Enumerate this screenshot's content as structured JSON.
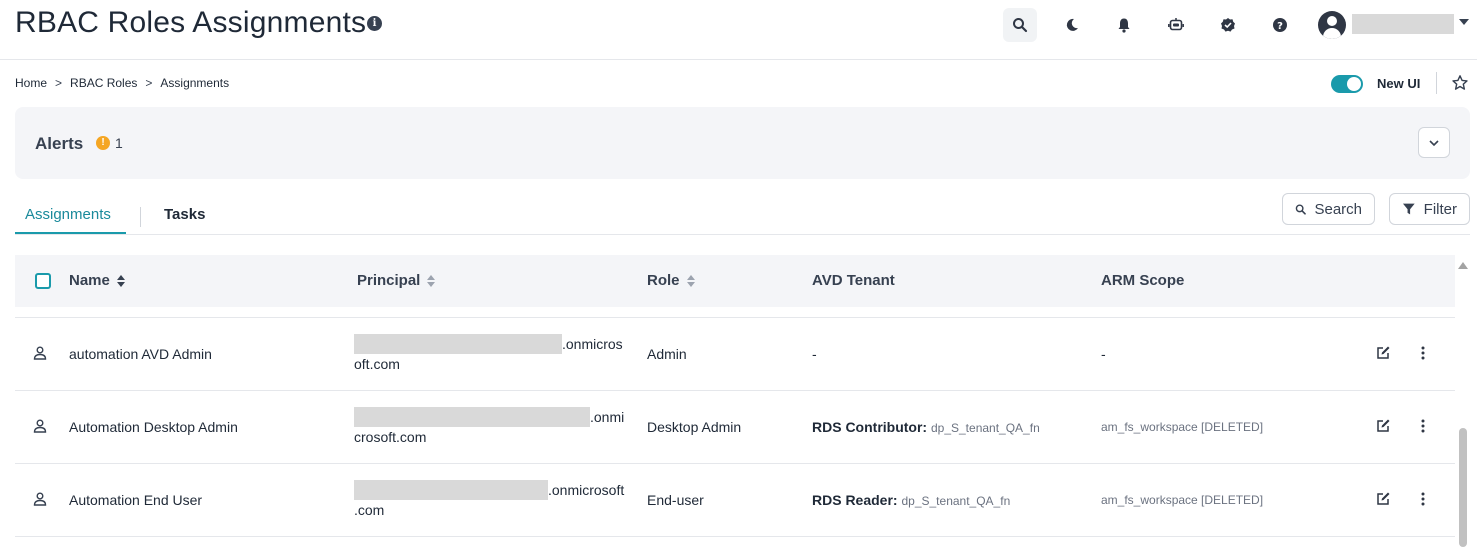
{
  "header": {
    "title": "RBAC Roles Assignments",
    "icons": [
      "search-icon",
      "moon-icon",
      "bell-icon",
      "bot-icon",
      "check-badge-icon",
      "help-icon",
      "user-icon"
    ]
  },
  "breadcrumb": {
    "items": [
      "Home",
      "RBAC Roles",
      "Assignments"
    ],
    "separator": ">"
  },
  "toggle": {
    "label": "New UI",
    "on": true
  },
  "alerts": {
    "title": "Alerts",
    "count": "1"
  },
  "tabs": {
    "assignments": "Assignments",
    "tasks": "Tasks"
  },
  "toolbar": {
    "search_label": "Search",
    "filter_label": "Filter"
  },
  "table": {
    "columns": {
      "name": "Name",
      "principal": "Principal",
      "role": "Role",
      "avd_tenant": "AVD Tenant",
      "arm_scope": "ARM Scope"
    },
    "rows": [
      {
        "name": "automation AVD Admin",
        "principal_suffix_line1": ".onmicros",
        "principal_suffix_line2": "oft.com",
        "role": "Admin",
        "tenant_role": "-",
        "tenant_name": "",
        "scope": "-"
      },
      {
        "name": "Automation Desktop Admin",
        "principal_suffix_line1": ".onmi",
        "principal_suffix_line2": "crosoft.com",
        "role": "Desktop Admin",
        "tenant_role": "RDS Contributor:",
        "tenant_name": "dp_S_tenant_QA_fn",
        "scope": "am_fs_workspace [DELETED]"
      },
      {
        "name": "Automation End User",
        "principal_suffix_line1": ".onmicrosoft",
        "principal_suffix_line2": ".com",
        "role": "End-user",
        "tenant_role": "RDS Reader:",
        "tenant_name": "dp_S_tenant_QA_fn",
        "scope": "am_fs_workspace [DELETED]"
      }
    ]
  },
  "colors": {
    "accent": "#1a9aab",
    "alert_warning": "#f5a623",
    "panel_bg": "#f4f5f8"
  }
}
